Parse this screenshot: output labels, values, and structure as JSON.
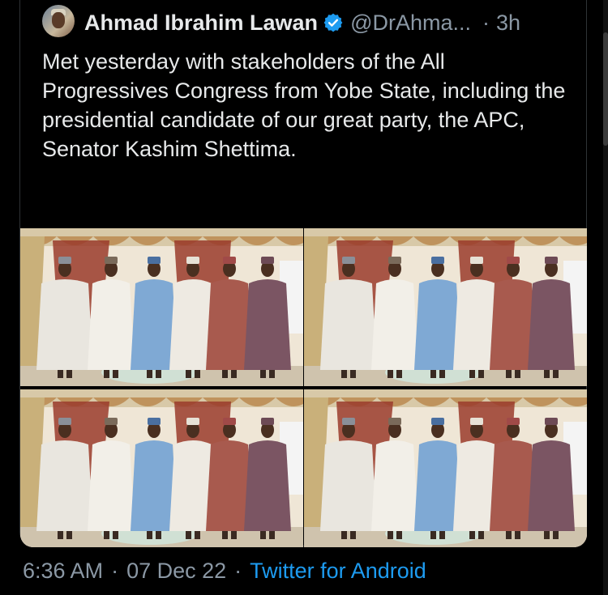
{
  "tweet": {
    "author_name": "Ahmad Ibrahim Lawan",
    "handle": "@DrAhma...",
    "separator": "·",
    "relative_time": "3h",
    "text": "Met yesterday with stakeholders of the All Progressives Congress from Yobe State, including the presidential candidate of our great party, the APC, Senator Kashim Shettima."
  },
  "footer": {
    "time": "6:36 AM",
    "date": "07 Dec 22",
    "separator": "·",
    "source": "Twitter for Android"
  },
  "icons": {
    "verified": "verified-badge-icon",
    "avatar": "profile-avatar"
  },
  "colors": {
    "background": "#000000",
    "text": "#e7e9ea",
    "secondary": "#8b98a5",
    "link": "#1d9bf0",
    "verified": "#1d9bf0"
  },
  "media": {
    "photo_count": 4
  }
}
